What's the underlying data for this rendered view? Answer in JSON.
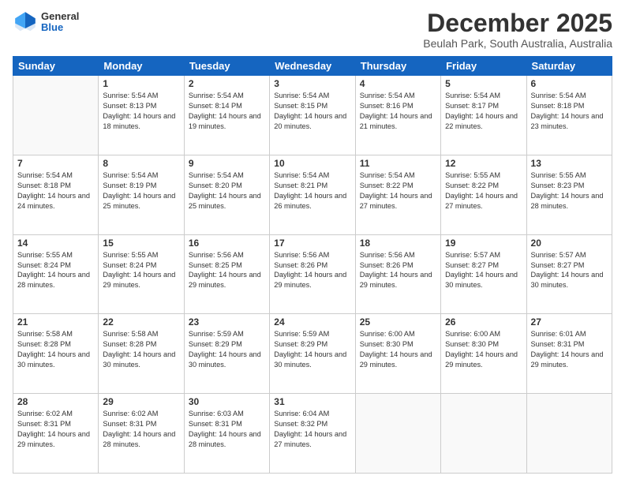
{
  "header": {
    "logo_general": "General",
    "logo_blue": "Blue",
    "month_title": "December 2025",
    "location": "Beulah Park, South Australia, Australia"
  },
  "days_of_week": [
    "Sunday",
    "Monday",
    "Tuesday",
    "Wednesday",
    "Thursday",
    "Friday",
    "Saturday"
  ],
  "weeks": [
    [
      {
        "day": "",
        "sunrise": "",
        "sunset": "",
        "daylight": ""
      },
      {
        "day": "1",
        "sunrise": "Sunrise: 5:54 AM",
        "sunset": "Sunset: 8:13 PM",
        "daylight": "Daylight: 14 hours and 18 minutes."
      },
      {
        "day": "2",
        "sunrise": "Sunrise: 5:54 AM",
        "sunset": "Sunset: 8:14 PM",
        "daylight": "Daylight: 14 hours and 19 minutes."
      },
      {
        "day": "3",
        "sunrise": "Sunrise: 5:54 AM",
        "sunset": "Sunset: 8:15 PM",
        "daylight": "Daylight: 14 hours and 20 minutes."
      },
      {
        "day": "4",
        "sunrise": "Sunrise: 5:54 AM",
        "sunset": "Sunset: 8:16 PM",
        "daylight": "Daylight: 14 hours and 21 minutes."
      },
      {
        "day": "5",
        "sunrise": "Sunrise: 5:54 AM",
        "sunset": "Sunset: 8:17 PM",
        "daylight": "Daylight: 14 hours and 22 minutes."
      },
      {
        "day": "6",
        "sunrise": "Sunrise: 5:54 AM",
        "sunset": "Sunset: 8:18 PM",
        "daylight": "Daylight: 14 hours and 23 minutes."
      }
    ],
    [
      {
        "day": "7",
        "sunrise": "Sunrise: 5:54 AM",
        "sunset": "Sunset: 8:18 PM",
        "daylight": "Daylight: 14 hours and 24 minutes."
      },
      {
        "day": "8",
        "sunrise": "Sunrise: 5:54 AM",
        "sunset": "Sunset: 8:19 PM",
        "daylight": "Daylight: 14 hours and 25 minutes."
      },
      {
        "day": "9",
        "sunrise": "Sunrise: 5:54 AM",
        "sunset": "Sunset: 8:20 PM",
        "daylight": "Daylight: 14 hours and 25 minutes."
      },
      {
        "day": "10",
        "sunrise": "Sunrise: 5:54 AM",
        "sunset": "Sunset: 8:21 PM",
        "daylight": "Daylight: 14 hours and 26 minutes."
      },
      {
        "day": "11",
        "sunrise": "Sunrise: 5:54 AM",
        "sunset": "Sunset: 8:22 PM",
        "daylight": "Daylight: 14 hours and 27 minutes."
      },
      {
        "day": "12",
        "sunrise": "Sunrise: 5:55 AM",
        "sunset": "Sunset: 8:22 PM",
        "daylight": "Daylight: 14 hours and 27 minutes."
      },
      {
        "day": "13",
        "sunrise": "Sunrise: 5:55 AM",
        "sunset": "Sunset: 8:23 PM",
        "daylight": "Daylight: 14 hours and 28 minutes."
      }
    ],
    [
      {
        "day": "14",
        "sunrise": "Sunrise: 5:55 AM",
        "sunset": "Sunset: 8:24 PM",
        "daylight": "Daylight: 14 hours and 28 minutes."
      },
      {
        "day": "15",
        "sunrise": "Sunrise: 5:55 AM",
        "sunset": "Sunset: 8:24 PM",
        "daylight": "Daylight: 14 hours and 29 minutes."
      },
      {
        "day": "16",
        "sunrise": "Sunrise: 5:56 AM",
        "sunset": "Sunset: 8:25 PM",
        "daylight": "Daylight: 14 hours and 29 minutes."
      },
      {
        "day": "17",
        "sunrise": "Sunrise: 5:56 AM",
        "sunset": "Sunset: 8:26 PM",
        "daylight": "Daylight: 14 hours and 29 minutes."
      },
      {
        "day": "18",
        "sunrise": "Sunrise: 5:56 AM",
        "sunset": "Sunset: 8:26 PM",
        "daylight": "Daylight: 14 hours and 29 minutes."
      },
      {
        "day": "19",
        "sunrise": "Sunrise: 5:57 AM",
        "sunset": "Sunset: 8:27 PM",
        "daylight": "Daylight: 14 hours and 30 minutes."
      },
      {
        "day": "20",
        "sunrise": "Sunrise: 5:57 AM",
        "sunset": "Sunset: 8:27 PM",
        "daylight": "Daylight: 14 hours and 30 minutes."
      }
    ],
    [
      {
        "day": "21",
        "sunrise": "Sunrise: 5:58 AM",
        "sunset": "Sunset: 8:28 PM",
        "daylight": "Daylight: 14 hours and 30 minutes."
      },
      {
        "day": "22",
        "sunrise": "Sunrise: 5:58 AM",
        "sunset": "Sunset: 8:28 PM",
        "daylight": "Daylight: 14 hours and 30 minutes."
      },
      {
        "day": "23",
        "sunrise": "Sunrise: 5:59 AM",
        "sunset": "Sunset: 8:29 PM",
        "daylight": "Daylight: 14 hours and 30 minutes."
      },
      {
        "day": "24",
        "sunrise": "Sunrise: 5:59 AM",
        "sunset": "Sunset: 8:29 PM",
        "daylight": "Daylight: 14 hours and 30 minutes."
      },
      {
        "day": "25",
        "sunrise": "Sunrise: 6:00 AM",
        "sunset": "Sunset: 8:30 PM",
        "daylight": "Daylight: 14 hours and 29 minutes."
      },
      {
        "day": "26",
        "sunrise": "Sunrise: 6:00 AM",
        "sunset": "Sunset: 8:30 PM",
        "daylight": "Daylight: 14 hours and 29 minutes."
      },
      {
        "day": "27",
        "sunrise": "Sunrise: 6:01 AM",
        "sunset": "Sunset: 8:31 PM",
        "daylight": "Daylight: 14 hours and 29 minutes."
      }
    ],
    [
      {
        "day": "28",
        "sunrise": "Sunrise: 6:02 AM",
        "sunset": "Sunset: 8:31 PM",
        "daylight": "Daylight: 14 hours and 29 minutes."
      },
      {
        "day": "29",
        "sunrise": "Sunrise: 6:02 AM",
        "sunset": "Sunset: 8:31 PM",
        "daylight": "Daylight: 14 hours and 28 minutes."
      },
      {
        "day": "30",
        "sunrise": "Sunrise: 6:03 AM",
        "sunset": "Sunset: 8:31 PM",
        "daylight": "Daylight: 14 hours and 28 minutes."
      },
      {
        "day": "31",
        "sunrise": "Sunrise: 6:04 AM",
        "sunset": "Sunset: 8:32 PM",
        "daylight": "Daylight: 14 hours and 27 minutes."
      },
      {
        "day": "",
        "sunrise": "",
        "sunset": "",
        "daylight": ""
      },
      {
        "day": "",
        "sunrise": "",
        "sunset": "",
        "daylight": ""
      },
      {
        "day": "",
        "sunrise": "",
        "sunset": "",
        "daylight": ""
      }
    ]
  ]
}
